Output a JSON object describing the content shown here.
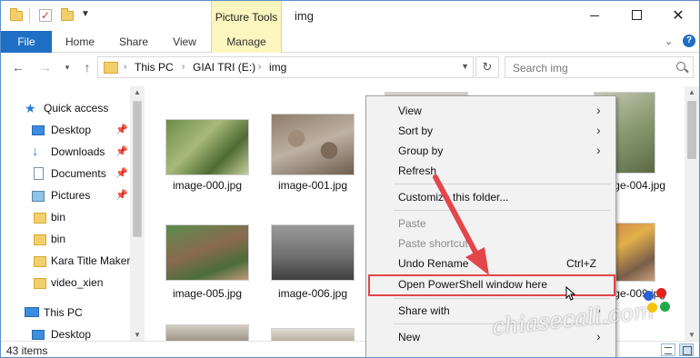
{
  "window": {
    "title": "img",
    "contextual_group": "Picture Tools"
  },
  "ribbon": {
    "tabs": [
      "File",
      "Home",
      "Share",
      "View",
      "Manage"
    ]
  },
  "address": {
    "segments": [
      "This PC",
      "GIAI TRI (E:)",
      "img"
    ],
    "search_placeholder": "Search img"
  },
  "nav_pane": {
    "quick_access_label": "Quick access",
    "items": [
      {
        "label": "Desktop",
        "icon": "desktop-icon",
        "pinned": true
      },
      {
        "label": "Downloads",
        "icon": "download-icon",
        "pinned": true
      },
      {
        "label": "Documents",
        "icon": "documents-icon",
        "pinned": true
      },
      {
        "label": "Pictures",
        "icon": "pictures-icon",
        "pinned": true
      },
      {
        "label": "bin",
        "icon": "folder-icon",
        "pinned": false
      },
      {
        "label": "bin",
        "icon": "folder-icon",
        "pinned": false
      },
      {
        "label": "Kara Title Maker",
        "icon": "folder-icon",
        "pinned": false
      },
      {
        "label": "video_xien",
        "icon": "folder-icon",
        "pinned": false
      }
    ],
    "this_pc_label": "This PC",
    "this_pc_child": "Desktop"
  },
  "files": [
    {
      "name": "image-000.jpg"
    },
    {
      "name": "image-001.jpg"
    },
    {
      "name": "image-004.jpg"
    },
    {
      "name": "image-005.jpg"
    },
    {
      "name": "image-006.jpg"
    },
    {
      "name": "image-009.jpg"
    }
  ],
  "status": {
    "item_count": "43 items"
  },
  "context_menu": {
    "view": "View",
    "sort_by": "Sort by",
    "group_by": "Group by",
    "refresh": "Refresh",
    "customize": "Customize this folder...",
    "paste": "Paste",
    "paste_shortcut": "Paste shortcut",
    "undo_rename": "Undo Rename",
    "undo_shortcut": "Ctrl+Z",
    "open_powershell": "Open PowerShell window here",
    "share_with": "Share with",
    "new": "New"
  },
  "watermark": "chiasecall.com",
  "colors": {
    "accent": "#1f6fc4",
    "contextual": "#fbf5bf",
    "highlight_box": "#e2464b",
    "arrow": "#e2464b"
  }
}
